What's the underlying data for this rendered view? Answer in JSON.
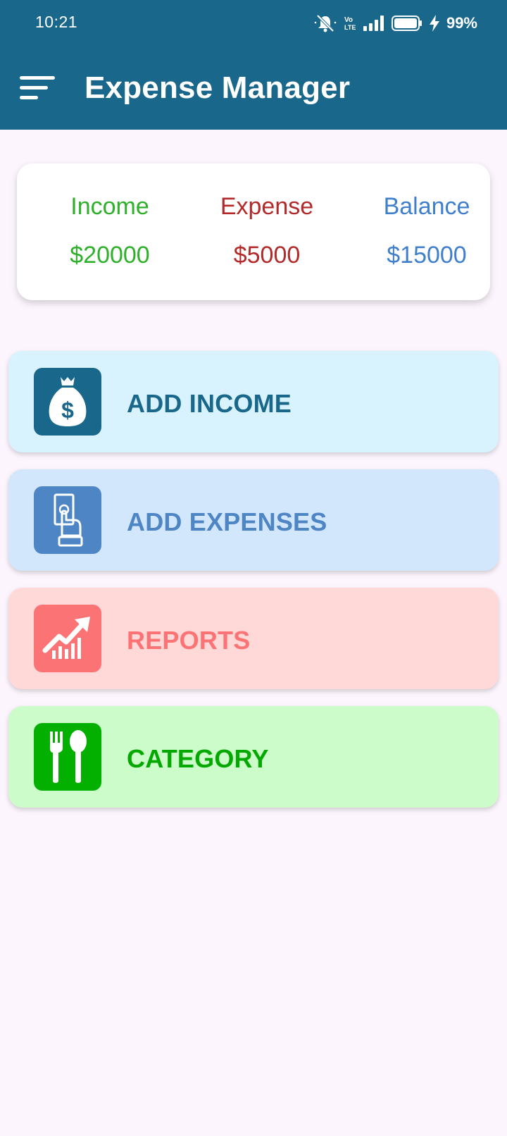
{
  "status_bar": {
    "time": "10:21",
    "battery_percent": "99%",
    "icons": [
      "mute-icon",
      "volte-icon",
      "signal-icon",
      "battery-icon",
      "charging-icon"
    ]
  },
  "app_bar": {
    "title": "Expense Manager",
    "menu_icon": "hamburger-menu-icon",
    "background": "#1a678c"
  },
  "summary": {
    "income_label": "Income",
    "income_value": "$20000",
    "expense_label": "Expense",
    "expense_value": "$5000",
    "balance_label": "Balance",
    "balance_value": "$15000",
    "colors": {
      "income": "#2fb02b",
      "expense": "#b22a2a",
      "balance": "#3f7fcb"
    }
  },
  "actions": [
    {
      "label": "ADD INCOME",
      "icon": "money-bag-icon",
      "color": "#1a678c",
      "background": "#d8f3fd"
    },
    {
      "label": "ADD EXPENSES",
      "icon": "hand-cash-icon",
      "color": "#4e85c4",
      "background": "#d2e6fc"
    },
    {
      "label": "REPORTS",
      "icon": "trending-chart-icon",
      "color": "#fc7376",
      "background": "#ffd8d8"
    },
    {
      "label": "CATEGORY",
      "icon": "fork-spoon-icon",
      "color": "#03b000",
      "background": "#ccfcca"
    }
  ]
}
